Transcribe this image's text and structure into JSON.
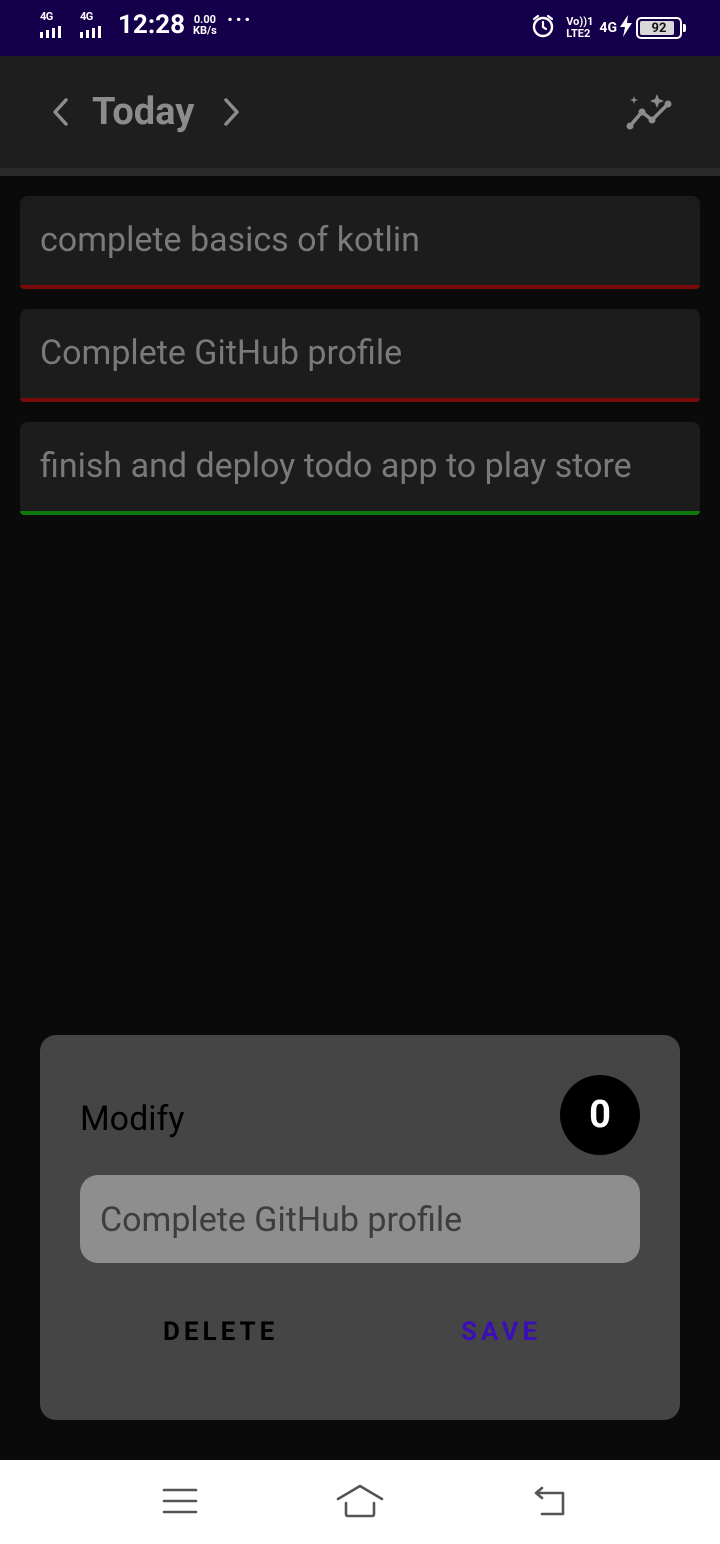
{
  "status_bar": {
    "sim1_type": "4G",
    "sim2_type": "4G",
    "time": "12:28",
    "speed_value": "0.00",
    "speed_unit": "KB/s",
    "more": "···",
    "volte_label": "Vo))1",
    "lte_label": "LTE2",
    "net2_label": "4G",
    "battery": "92",
    "icons": [
      "alarm-icon",
      "charging-icon",
      "battery-icon"
    ]
  },
  "app_bar": {
    "title": "Today",
    "icons": [
      "chevron-left-icon",
      "chevron-right-icon",
      "stats-sparkle-icon"
    ]
  },
  "tasks": [
    {
      "text": "complete basics of kotlin",
      "status_color": "#7a0b0b"
    },
    {
      "text": "Complete GitHub profile",
      "status_color": "#7a0b0b"
    },
    {
      "text": "finish and deploy todo app to play store",
      "status_color": "#0d7a0d"
    }
  ],
  "dialog": {
    "title": "Modify",
    "counter": "0",
    "input_value": "Complete GitHub profile",
    "delete_label": "DELETE",
    "save_label": "SAVE"
  },
  "nav_bar": {
    "icons": [
      "menu-icon",
      "home-icon",
      "back-icon"
    ]
  }
}
